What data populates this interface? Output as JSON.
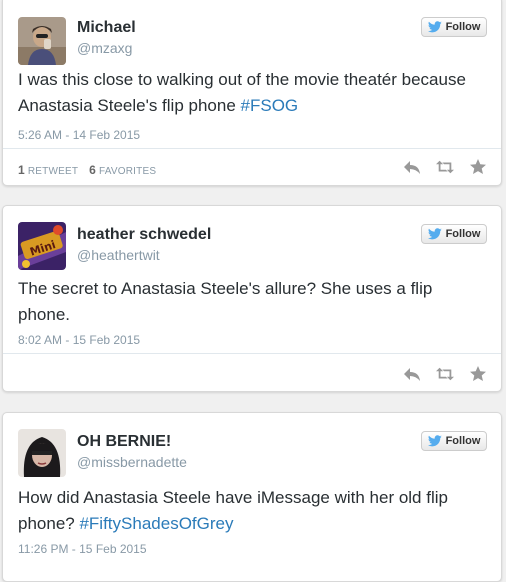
{
  "colors": {
    "link": "#2b7bb9",
    "meta": "#8899a6",
    "text": "#292f33",
    "icon": "#999999",
    "twitter_bird": "#55acee"
  },
  "tweets": [
    {
      "name": "Michael",
      "handle": "@mzaxg",
      "follow_label": "Follow",
      "text": "I was this close to walking out of the movie theatér because Anastasia Steele's flip phone",
      "hashtag": "#FSOG",
      "timestamp": "5:26 AM - 14 Feb 2015",
      "retweets": "1",
      "retweets_label": "RETWEET",
      "favorites": "6",
      "favorites_label": "FAVORITES",
      "icons": [
        "reply-icon",
        "retweet-icon",
        "favorite-icon"
      ]
    },
    {
      "name": "heather schwedel",
      "handle": "@heathertwit",
      "follow_label": "Follow",
      "text": "The secret to Anastasia Steele's allure? She uses a flip phone.",
      "timestamp": "8:02 AM - 15 Feb 2015",
      "icons": [
        "reply-icon",
        "retweet-icon",
        "favorite-icon"
      ]
    },
    {
      "name": "OH BERNIE!",
      "handle": "@missbernadette",
      "follow_label": "Follow",
      "text": "How did Anastasia Steele have iMessage with her old flip phone?",
      "hashtag": "#FiftyShadesOfGrey",
      "timestamp": "11:26 PM - 15 Feb 2015"
    }
  ]
}
